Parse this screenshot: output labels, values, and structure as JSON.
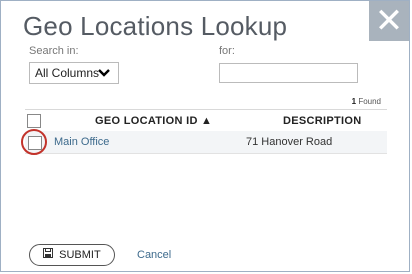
{
  "dialog": {
    "title": "Geo Locations Lookup",
    "close_glyph": "✕"
  },
  "search": {
    "search_in_label": "Search in:",
    "search_in_value": "All Columns",
    "for_label": "for:",
    "for_value": ""
  },
  "results": {
    "found_count": "1",
    "found_label": "Found",
    "columns": [
      "GEO LOCATION ID ▲",
      "DESCRIPTION"
    ],
    "rows": [
      {
        "id": "Main Office",
        "description": "71 Hanover Road"
      }
    ]
  },
  "footer": {
    "submit_label": "SUBMIT",
    "submit_icon": "save-icon",
    "cancel_label": "Cancel"
  }
}
